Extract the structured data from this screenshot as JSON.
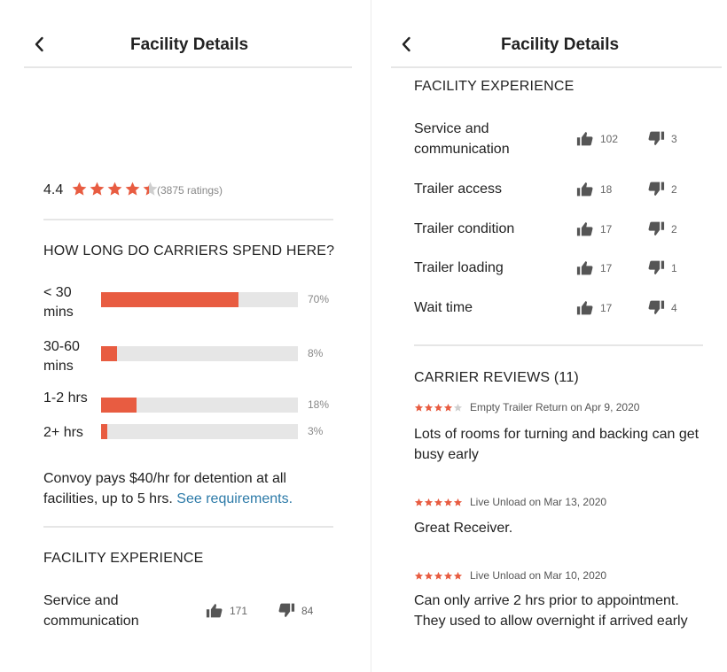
{
  "colors": {
    "accent": "#e85c41",
    "link": "#2c7aa8",
    "track": "#e6e6e6",
    "icon": "#555555"
  },
  "icons": {
    "back": "chevron-left-icon",
    "up": "thumbs-up-icon",
    "down": "thumbs-down-icon",
    "star": "star-icon"
  },
  "left": {
    "title": "Facility Details",
    "rating": {
      "value": "4.4",
      "stars": 4.4,
      "count": "(3875 ratings)"
    },
    "durations": {
      "heading": "HOW LONG DO CARRIERS SPEND HERE?",
      "rows": [
        {
          "label": "< 30 mins",
          "percent": 70,
          "percent_label": "70%"
        },
        {
          "label": "30-60 mins",
          "percent": 8,
          "percent_label": "8%"
        },
        {
          "label": "1-2 hrs",
          "percent": 18,
          "percent_label": "18%"
        },
        {
          "label": "2+ hrs",
          "percent": 3,
          "percent_label": "3%"
        }
      ]
    },
    "detention": {
      "text": "Convoy pays $40/hr for detention at all facilities, up to 5 hrs.",
      "link": "See requirements."
    },
    "experience": {
      "heading": "FACILITY EXPERIENCE",
      "rows": [
        {
          "label": "Service and communication",
          "up": "171",
          "down": "84"
        }
      ]
    }
  },
  "right": {
    "title": "Facility Details",
    "experience": {
      "heading": "FACILITY EXPERIENCE",
      "rows": [
        {
          "label": "Service and communication",
          "up": "102",
          "down": "3"
        },
        {
          "label": "Trailer access",
          "up": "18",
          "down": "2"
        },
        {
          "label": "Trailer condition",
          "up": "17",
          "down": "2"
        },
        {
          "label": "Trailer loading",
          "up": "17",
          "down": "1"
        },
        {
          "label": "Wait time",
          "up": "17",
          "down": "4"
        }
      ]
    },
    "reviews": {
      "heading": "CARRIER REVIEWS (11)",
      "items": [
        {
          "stars": 4,
          "meta": "Empty Trailer Return on Apr 9, 2020",
          "text": "Lots of rooms for turning and backing can get busy early"
        },
        {
          "stars": 5,
          "meta": "Live Unload on Mar 13, 2020",
          "text": "Great Receiver."
        },
        {
          "stars": 5,
          "meta": "Live Unload on Mar 10, 2020",
          "text": "Can only arrive 2 hrs prior to appointment. They used to allow overnight if arrived early"
        }
      ]
    }
  }
}
